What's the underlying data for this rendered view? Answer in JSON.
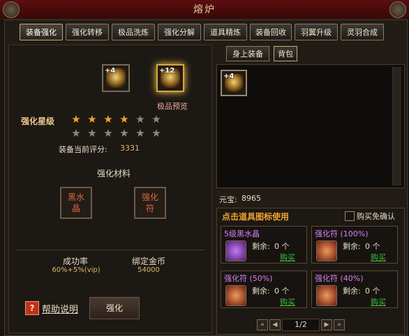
{
  "window": {
    "title": "熔炉"
  },
  "tabs": [
    {
      "label": "装备强化",
      "active": true
    },
    {
      "label": "强化转移"
    },
    {
      "label": "极品洗炼"
    },
    {
      "label": "强化分解"
    },
    {
      "label": "道具精炼"
    },
    {
      "label": "装备回收"
    },
    {
      "label": "羽翼升级"
    },
    {
      "label": "灵羽合成"
    }
  ],
  "forge": {
    "left_item": {
      "plus": "+4"
    },
    "right_item": {
      "plus": "+12",
      "caption": "极品预览"
    },
    "star_label": "强化星级",
    "stars_current": 4,
    "stars_row1_total": 6,
    "stars_row2_total": 6,
    "score_label": "装备当前评分:",
    "score_value": "3331",
    "materials_title": "强化材料",
    "material1": "黑水晶",
    "material2": "强化符",
    "success_label": "成功率",
    "success_value": "60%+5%(vip)",
    "gold_label": "绑定金币",
    "gold_value": "54000",
    "help_icon": "?",
    "help_text": "帮助说明",
    "enhance_button": "强化"
  },
  "bag": {
    "tab_equipped": "身上装备",
    "tab_bag": "背包",
    "item_plus": "+4",
    "yuanbao_label": "元宝:",
    "yuanbao_value": "8965"
  },
  "shop": {
    "header": "点击道具图标使用",
    "checkbox_label": "购买免确认",
    "items": [
      {
        "name": "5级黑水晶",
        "remain_label": "剩余:",
        "remain": "0 个",
        "buy": "购买",
        "icon": "purple-crystal-icon",
        "color": "#b05ad6"
      },
      {
        "name": "强化符 (100%)",
        "remain_label": "剩余:",
        "remain": "0 个",
        "buy": "购买",
        "icon": "talisman-icon",
        "color": "#c94b2a"
      },
      {
        "name": "强化符 (50%)",
        "remain_label": "剩余:",
        "remain": "0 个",
        "buy": "购买",
        "icon": "talisman-icon",
        "color": "#c94b2a"
      },
      {
        "name": "强化符 (40%)",
        "remain_label": "剩余:",
        "remain": "0 个",
        "buy": "购买",
        "icon": "talisman-icon",
        "color": "#c94b2a"
      }
    ],
    "pager": {
      "page": "1/2"
    }
  },
  "colors": {
    "accent": "#f1a526",
    "buy": "#3fc23b",
    "name_pink": "#d383f0"
  }
}
